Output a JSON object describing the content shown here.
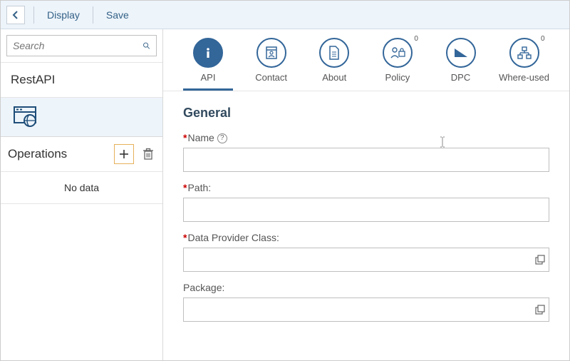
{
  "toolbar": {
    "display": "Display",
    "save": "Save"
  },
  "sidebar": {
    "search_placeholder": "Search",
    "title": "RestAPI",
    "operations_label": "Operations",
    "no_data": "No data"
  },
  "tabs": [
    {
      "key": "api",
      "label": "API",
      "badge": null
    },
    {
      "key": "contact",
      "label": "Contact",
      "badge": null
    },
    {
      "key": "about",
      "label": "About",
      "badge": null
    },
    {
      "key": "policy",
      "label": "Policy",
      "badge": "0"
    },
    {
      "key": "dpc",
      "label": "DPC",
      "badge": null
    },
    {
      "key": "whereused",
      "label": "Where-used",
      "badge": "0"
    }
  ],
  "form": {
    "section": "General",
    "name_label": "Name",
    "name_value": "",
    "path_label": "Path:",
    "path_value": "",
    "dpc_label": "Data Provider Class:",
    "dpc_value": "",
    "package_label": "Package:",
    "package_value": ""
  }
}
